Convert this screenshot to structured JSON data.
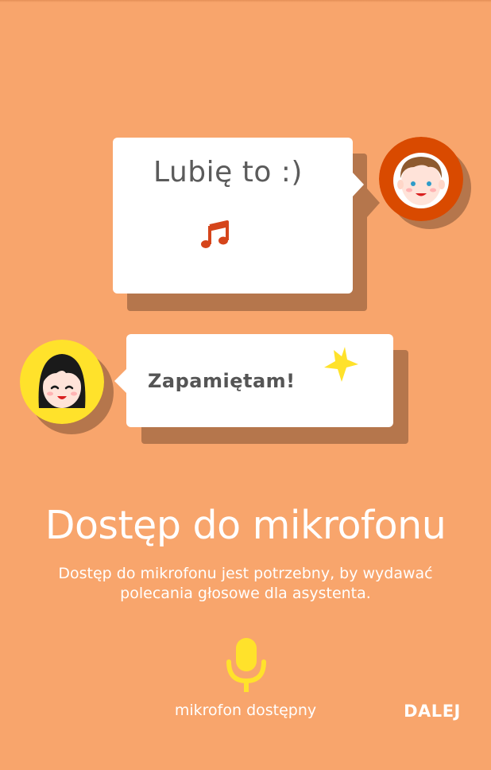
{
  "illustration": {
    "bubble_top": {
      "text": "Lubię to :)",
      "icon": "music-note-icon"
    },
    "bubble_bottom": {
      "text": "Zapamiętam!",
      "icon": "star-icon"
    },
    "avatars": {
      "boy": "boy-avatar-icon",
      "girl": "girl-avatar-icon"
    }
  },
  "onboarding": {
    "title": "Dostęp do mikrofonu",
    "description": "Dostęp do mikrofonu jest potrzebny, by wydawać polecania głosowe dla asystenta.",
    "mic_status": "mikrofon dostępny",
    "mic_icon": "microphone-icon",
    "next_label": "DALEJ"
  },
  "colors": {
    "background": "#F8A56C",
    "shadow": "#B5764C",
    "accent_yellow": "#FFE22B",
    "boy_ring": "#D94A00",
    "girl_ring": "#FFE22B",
    "note": "#D5451B"
  }
}
